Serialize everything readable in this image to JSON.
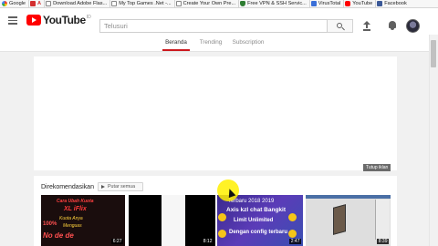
{
  "bookmarks": [
    {
      "label": "Google",
      "icon": "google-icon"
    },
    {
      "label": "A",
      "icon": "adobe-icon"
    },
    {
      "label": "Download Adobe Flas...",
      "icon": "document-icon"
    },
    {
      "label": "My Top Games .Net -...",
      "icon": "document-icon"
    },
    {
      "label": "Create Your Own Pre...",
      "icon": "document-icon"
    },
    {
      "label": "Free VPN & SSH Servic...",
      "icon": "shield-icon"
    },
    {
      "label": "VirusTotal",
      "icon": "virustotal-icon"
    },
    {
      "label": "YouTube",
      "icon": "youtube-icon"
    },
    {
      "label": "Facebook",
      "icon": "facebook-icon"
    }
  ],
  "header": {
    "logo_text": "YouTube",
    "logo_region": "ID",
    "search_placeholder": "Telusuri"
  },
  "tabs": [
    {
      "label": "Beranda",
      "active": true
    },
    {
      "label": "Trending",
      "active": false
    },
    {
      "label": "Subscription",
      "active": false
    }
  ],
  "ad": {
    "close_label": "Tutup iklan"
  },
  "recommended": {
    "title": "Direkomendasikan",
    "play_all_label": "Putar semua",
    "videos": [
      {
        "duration": "6:27",
        "overlay_lines": [
          "Cara Ubah Kuota",
          "XL iFlix",
          "Kuota Anya",
          "Menguas",
          "100%",
          "No de de"
        ]
      },
      {
        "duration": ""
      },
      {
        "duration": "8:12"
      },
      {
        "duration": "2:47",
        "overlay_lines": [
          "Terbaru 2018 2019",
          "Axis kzl chat Bangkit",
          "Limit Unlimited",
          "Dengan config terbaru"
        ]
      },
      {
        "duration": "8:39"
      }
    ]
  },
  "colors": {
    "youtube_red": "#ff0000",
    "active_tab_underline": "#cc181e",
    "cursor_highlight": "#fff000"
  }
}
